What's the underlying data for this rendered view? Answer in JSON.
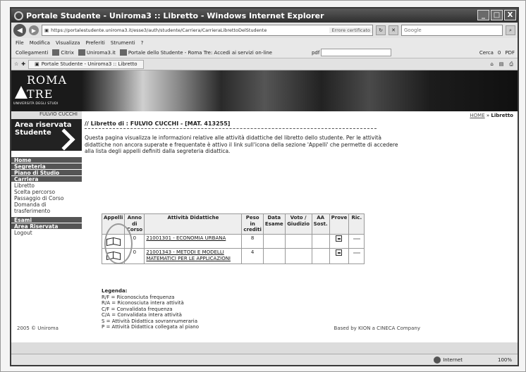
{
  "window": {
    "title": "Portale Studente - Uniroma3 :: Libretto - Windows Internet Explorer",
    "controls": [
      "_",
      "□",
      "X"
    ]
  },
  "address_bar": {
    "url": "https://portalestudente.uniroma3.it/esse3/auth/studente/Carriera/CarrieraLibrettoDelStudente",
    "cert": "Errore certificato",
    "search_placeholder": "Google"
  },
  "menu": [
    "File",
    "Modifica",
    "Visualizza",
    "Preferiti",
    "Strumenti",
    "?"
  ],
  "favorites": {
    "label": "Collegamenti",
    "items": [
      "Citrix",
      "Uniroma3.it",
      "Portale dello Studente - Roma Tre: Accedi ai servizi on-line"
    ],
    "pdf": "pdf",
    "right": [
      "Cerca",
      "0",
      "PDF"
    ]
  },
  "tab": {
    "label": "Portale Studente - Uniroma3 :: Libretto"
  },
  "banner": {
    "logo_line1": "ROMA",
    "logo_line2": "TRE",
    "logo_line3": "UNIVERSITÀ DEGLI STUDI"
  },
  "user": {
    "name": "FULVIO CUCCHI"
  },
  "breadcrumb": {
    "home": "HOME",
    "separator": "»",
    "current": "Libretto"
  },
  "sidebar": {
    "area_title": "Area riservata Studente",
    "items": [
      {
        "label": "Home",
        "type": "hd"
      },
      {
        "label": "Segreteria",
        "type": "hd"
      },
      {
        "label": "Piano di Studio",
        "type": "hd"
      },
      {
        "label": "Carriera",
        "type": "hd"
      },
      {
        "label": "Libretto",
        "type": "sub"
      },
      {
        "label": "Scelta percorso",
        "type": "sub"
      },
      {
        "label": "Passaggio di Corso",
        "type": "sub"
      },
      {
        "label": "Domanda di trasferimento",
        "type": "sub"
      },
      {
        "label": "Esami",
        "type": "hd"
      },
      {
        "label": "Area Riservata",
        "type": "hd"
      },
      {
        "label": "Logout",
        "type": "sub"
      }
    ]
  },
  "content": {
    "title": "// Libretto di : FULVIO CUCCHI - [MAT. 413255]",
    "intro": "Questa pagina visualizza le informazioni relative alle attività didattiche del libretto dello studente. Per le attività didattiche non ancora superate e frequentate è attivo il link sull'icona della sezione 'Appelli' che permette di accedere alla lista degli appelli definiti dalla segreteria didattica."
  },
  "table": {
    "headers": [
      "Appelli",
      "Anno di Corso",
      "Attività Didattiche",
      "Peso in crediti",
      "Data Esame",
      "Voto / Giudizio",
      "AA Sost.",
      "Prove",
      "Ric."
    ],
    "rows": [
      {
        "anno": "0",
        "attivita": "21001301 - ECONOMIA URBANA",
        "peso": "8",
        "data": "",
        "voto": "",
        "aa": ""
      },
      {
        "anno": "0",
        "attivita": "21001343 - METODI E MODELLI MATEMATICI PER LE APPLICAZIONI",
        "peso": "4",
        "data": "",
        "voto": "",
        "aa": ""
      }
    ]
  },
  "legend": {
    "title": "Legenda:",
    "items": [
      "R/F = Riconosciuta frequenza",
      "R/A = Riconosciuta intera attività",
      "C/F = Convalidata frequenza",
      "C/A = Convalidata intera attività",
      "S = Attività Didattica sovrannumeraria",
      "P = Attività Didattica collegata al piano"
    ]
  },
  "footer": {
    "left": "2005 © Uniroma",
    "right": "Based by KION a CINECA Company"
  },
  "status": {
    "zone": "Internet",
    "zoom": "100%"
  }
}
